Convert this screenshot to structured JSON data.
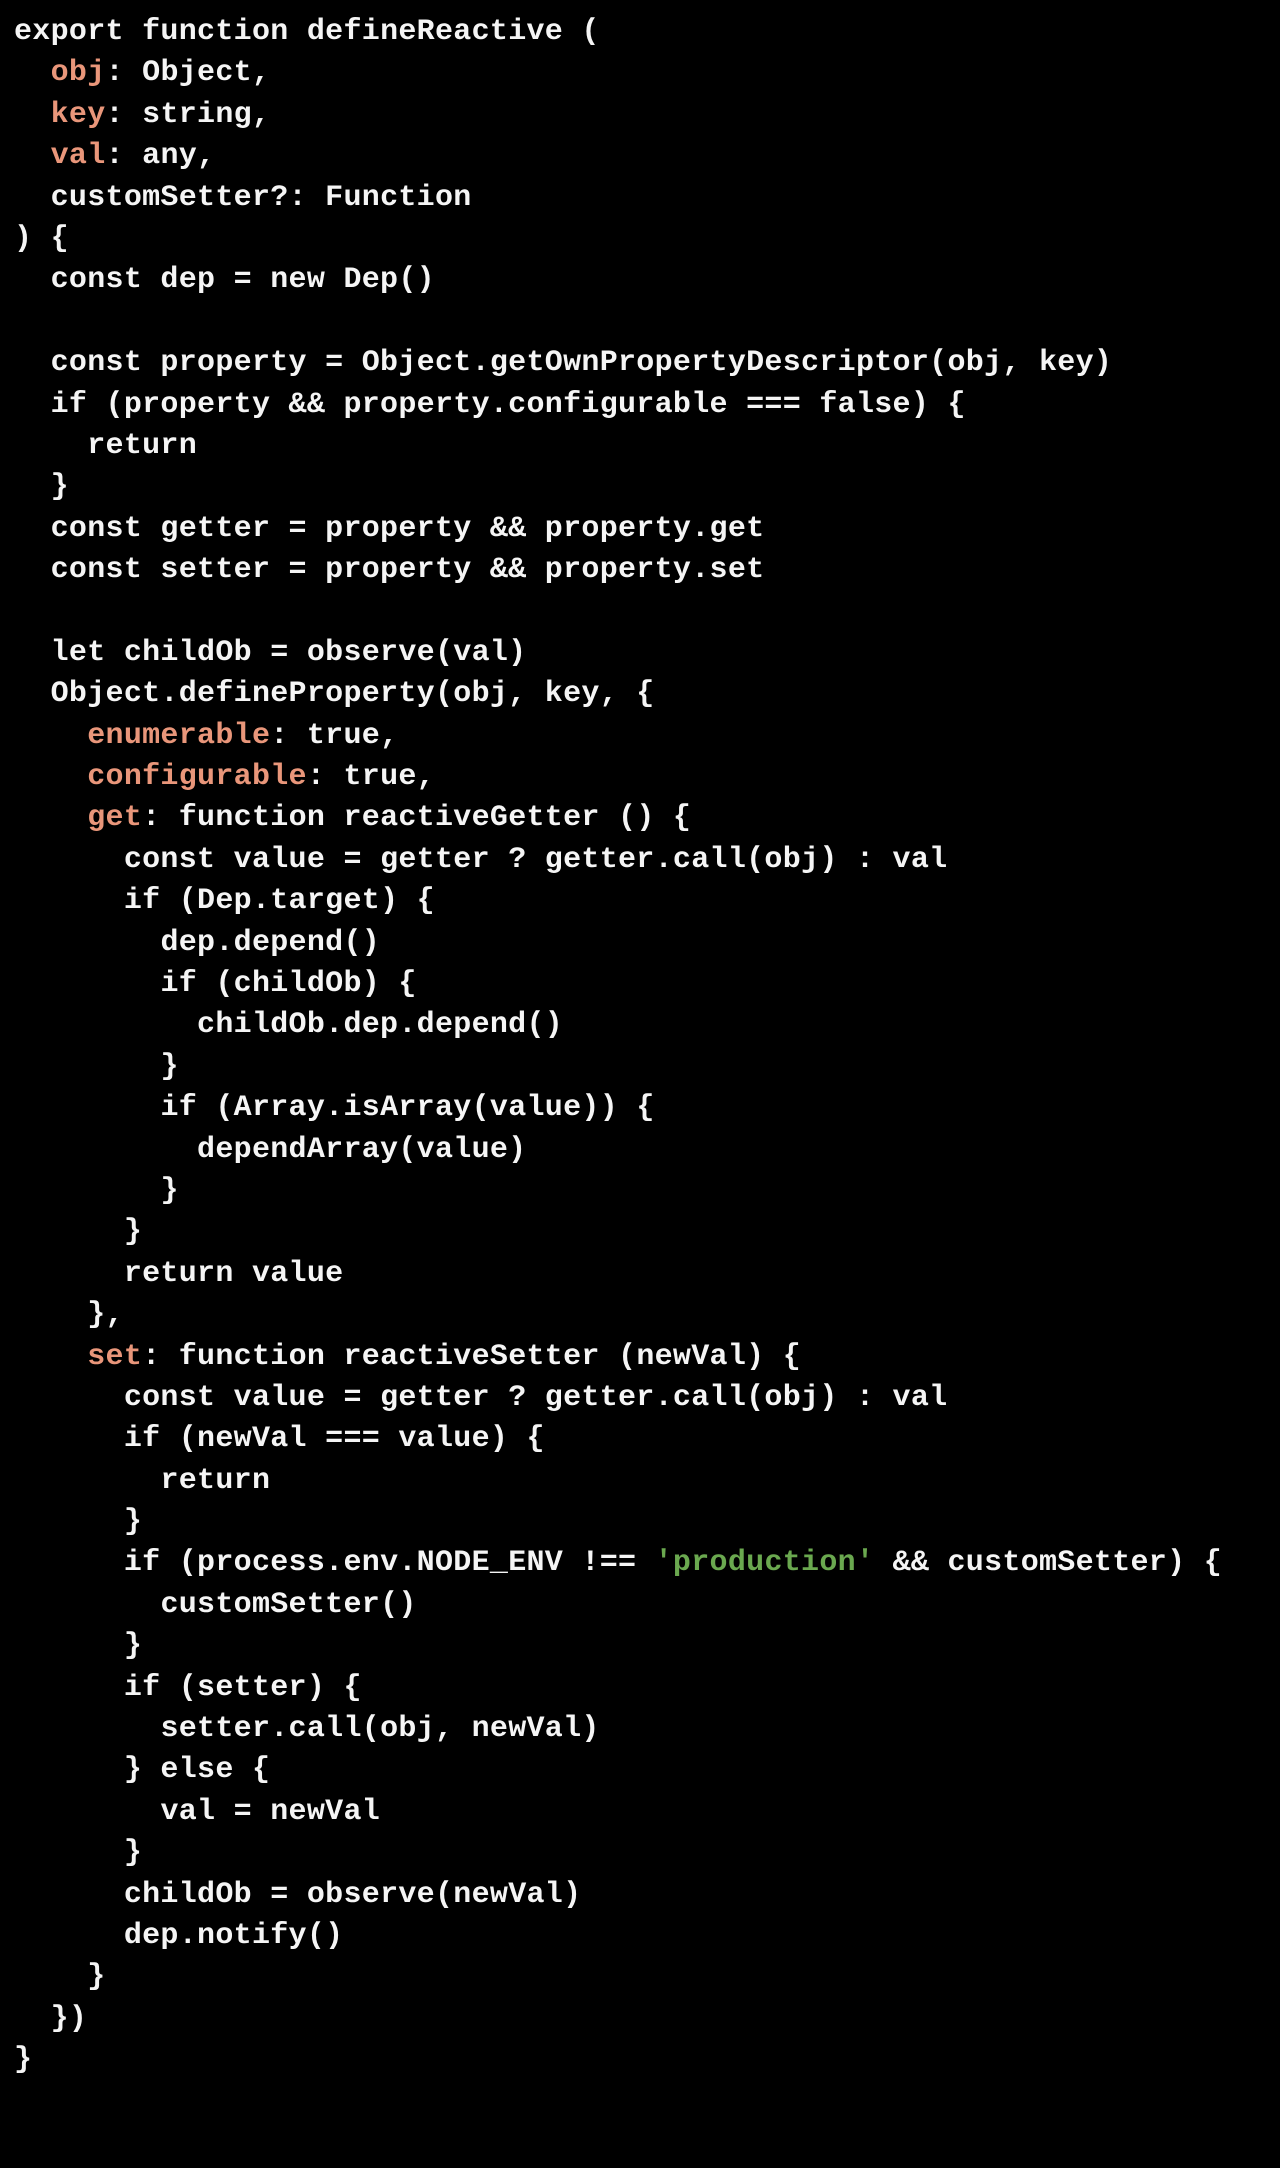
{
  "code": {
    "tokens": [
      "defineReactive",
      "obj",
      "key",
      "val",
      "customSetter",
      "enumerable",
      "configurable",
      "get",
      "set",
      "'production'"
    ],
    "lines": {
      "l01": "export function ",
      "l01b": " (",
      "l02a": "  ",
      "l02b": ": Object,",
      "l03a": "  ",
      "l03b": ": string,",
      "l04a": "  ",
      "l04b": ": any,",
      "l05a": "  ",
      "l05b": "?: Function",
      "l06": ") {",
      "l07": "  const dep = new Dep()",
      "l08": "",
      "l09": "  const property = Object.getOwnPropertyDescriptor(obj, key)",
      "l10": "  if (property && property.configurable === false) {",
      "l11": "    return",
      "l12": "  }",
      "l13": "  const getter = property && property.get",
      "l14": "  const setter = property && property.set",
      "l15": "",
      "l16": "  let childOb = observe(val)",
      "l17": "  Object.defineProperty(obj, key, {",
      "l18a": "    ",
      "l18b": ": true,",
      "l19a": "    ",
      "l19b": ": true,",
      "l20a": "    ",
      "l20b": ": function reactiveGetter () {",
      "l21": "      const value = getter ? getter.call(obj) : val",
      "l22": "      if (Dep.target) {",
      "l23": "        dep.depend()",
      "l24": "        if (childOb) {",
      "l25": "          childOb.dep.depend()",
      "l26": "        }",
      "l27": "        if (Array.isArray(value)) {",
      "l28": "          dependArray(value)",
      "l29": "        }",
      "l30": "      }",
      "l31": "      return value",
      "l32": "    },",
      "l33a": "    ",
      "l33b": ": function reactiveSetter (newVal) {",
      "l34": "      const value = getter ? getter.call(obj) : val",
      "l35": "      if (newVal === value) {",
      "l36": "        return",
      "l37": "      }",
      "l38a": "      if (process.env.NODE_ENV !== ",
      "l38b": " && customSetter) {",
      "l39": "        customSetter()",
      "l40": "      }",
      "l41": "      if (setter) {",
      "l42": "        setter.call(obj, newVal)",
      "l43": "      } else {",
      "l44": "        val = newVal",
      "l45": "      }",
      "l46": "      childOb = observe(newVal)",
      "l47": "      dep.notify()",
      "l48": "    }",
      "l49": "  })",
      "l50": "}"
    }
  }
}
